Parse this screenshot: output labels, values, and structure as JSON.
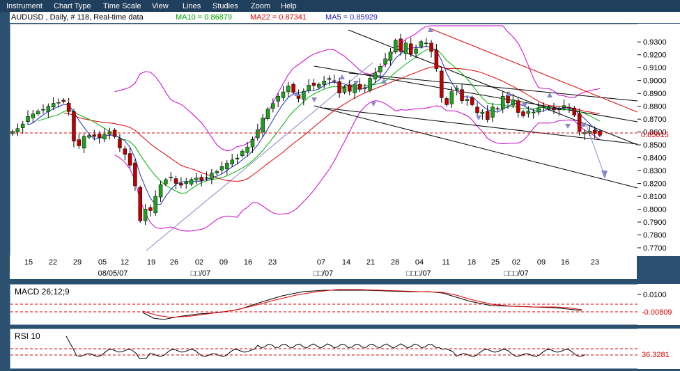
{
  "menu": [
    "Instrument",
    "Chart Type",
    "Time Scale",
    "View",
    "Lines",
    "Studies",
    "Zoom",
    "Help"
  ],
  "header": {
    "symbol_text": "AUDUSD , Daily, # 118, Real-time data",
    "ma10": "MA10 = 0.86879",
    "ma22": "MA22 = 0.87341",
    "ma5": "MA5 = 0.85929",
    "ma10_color": "#00a000",
    "ma22_color": "#e00000",
    "ma5_color": "#2020c0"
  },
  "price_axis": {
    "ticks": [
      "0.9300",
      "0.9200",
      "0.9100",
      "0.9000",
      "0.8900",
      "0.8800",
      "0.8700",
      "0.8600",
      "0.8500",
      "0.8400",
      "0.8300",
      "0.8200",
      "0.8100",
      "0.8000",
      "0.7900",
      "0.7800",
      "0.7700"
    ],
    "current_price": "0.85815",
    "current_price_color": "#e00000"
  },
  "date_axis": {
    "day_labels": [
      "15",
      "22",
      "29",
      "05",
      "12",
      "19",
      "26",
      "02",
      "09",
      "16",
      "23",
      "07",
      "14",
      "21",
      "28",
      "04",
      "11",
      "18",
      "25",
      "02",
      "09",
      "16",
      "23"
    ],
    "month_labels": [
      "08/05/07",
      "□□/07",
      "□□/07",
      "□□□/07",
      "□□□/07"
    ]
  },
  "macd": {
    "title": "MACD 26;12;9",
    "tick": "0.0100",
    "value": "-0.00809"
  },
  "rsi": {
    "title": "RSI 10",
    "value": "36.3281"
  },
  "chart_data": {
    "type": "candlestick",
    "title": "AUDUSD , Daily, # 118, Real-time data",
    "ylim": [
      0.765,
      0.94
    ],
    "close": [
      0.8611,
      0.8632,
      0.8668,
      0.8727,
      0.8746,
      0.8767,
      0.8781,
      0.8805,
      0.8828,
      0.8835,
      0.8842,
      0.8764,
      0.8534,
      0.8498,
      0.8571,
      0.8578,
      0.8571,
      0.8562,
      0.8587,
      0.8608,
      0.8569,
      0.8481,
      0.8432,
      0.8347,
      0.8187,
      0.7915,
      0.8006,
      0.7995,
      0.8106,
      0.8196,
      0.8235,
      0.8255,
      0.8206,
      0.8192,
      0.8218,
      0.8237,
      0.8248,
      0.8229,
      0.8251,
      0.8286,
      0.8298,
      0.8337,
      0.8363,
      0.8388,
      0.8403,
      0.8457,
      0.8489,
      0.8548,
      0.8622,
      0.8714,
      0.8783,
      0.8827,
      0.8883,
      0.8917,
      0.8964,
      0.8914,
      0.8866,
      0.8922,
      0.8969,
      0.8966,
      0.8975,
      0.9002,
      0.9022,
      0.9003,
      0.8908,
      0.8954,
      0.8922,
      0.8976,
      0.8937,
      0.8947,
      0.9022,
      0.9065,
      0.9115,
      0.9174,
      0.9227,
      0.9317,
      0.9231,
      0.9297,
      0.9211,
      0.9252,
      0.9308,
      0.9297,
      0.9231,
      0.9098,
      0.8872,
      0.8818,
      0.8919,
      0.8947,
      0.8849,
      0.886,
      0.8817,
      0.8755,
      0.876,
      0.8702,
      0.88,
      0.8783,
      0.8883,
      0.8832,
      0.8855,
      0.8757,
      0.8731,
      0.8768,
      0.876,
      0.8788,
      0.8804,
      0.8798,
      0.8777,
      0.8778,
      0.881,
      0.8792,
      0.8737,
      0.8609,
      0.8603,
      0.8613,
      0.8594,
      0.858
    ]
  },
  "colors": {
    "bull": "#20a020",
    "bear": "#c00000",
    "ma10": "#00b000",
    "ma22": "#e00000",
    "ma5": "#2030c0",
    "bollinger": "#cc00cc",
    "trendline": "#000000",
    "red_trend": "#e00000",
    "arrow": "#8888cc",
    "dashed": "#e00000"
  }
}
